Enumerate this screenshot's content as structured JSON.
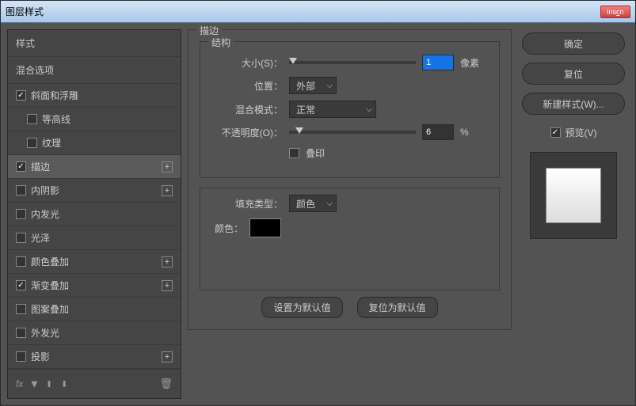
{
  "title": "图层样式",
  "close": "✕",
  "left": {
    "styles": "样式",
    "blend": "混合选项",
    "items": [
      {
        "label": "斜面和浮雕",
        "checked": true,
        "plus": false,
        "sub": false
      },
      {
        "label": "等高线",
        "checked": false,
        "plus": false,
        "sub": true
      },
      {
        "label": "纹理",
        "checked": false,
        "plus": false,
        "sub": true
      },
      {
        "label": "描边",
        "checked": true,
        "plus": true,
        "sub": false,
        "selected": true
      },
      {
        "label": "内阴影",
        "checked": false,
        "plus": true,
        "sub": false
      },
      {
        "label": "内发光",
        "checked": false,
        "plus": false,
        "sub": false
      },
      {
        "label": "光泽",
        "checked": false,
        "plus": false,
        "sub": false
      },
      {
        "label": "颜色叠加",
        "checked": false,
        "plus": true,
        "sub": false
      },
      {
        "label": "渐变叠加",
        "checked": true,
        "plus": true,
        "sub": false
      },
      {
        "label": "图案叠加",
        "checked": false,
        "plus": false,
        "sub": false
      },
      {
        "label": "外发光",
        "checked": false,
        "plus": false,
        "sub": false
      },
      {
        "label": "投影",
        "checked": false,
        "plus": true,
        "sub": false
      }
    ],
    "fx": "fx",
    "trash": "🗑"
  },
  "center": {
    "stroke": "描边",
    "structure": "结构",
    "size_label": "大小(S)：",
    "size_value": "1",
    "px": "像素",
    "position_label": "位置：",
    "position_value": "外部",
    "blend_mode_label": "混合模式：",
    "blend_mode_value": "正常",
    "opacity_label": "不透明度(O)：",
    "opacity_value": "6",
    "pct": "%",
    "overprint": "叠印",
    "fill_type_label": "填充类型：",
    "fill_type_value": "颜色",
    "color_label": "颜色：",
    "set_default": "设置为默认值",
    "reset_default": "复位为默认值"
  },
  "right": {
    "ok": "确定",
    "reset": "复位",
    "new_style": "新建样式(W)...",
    "preview": "预览(V)"
  }
}
